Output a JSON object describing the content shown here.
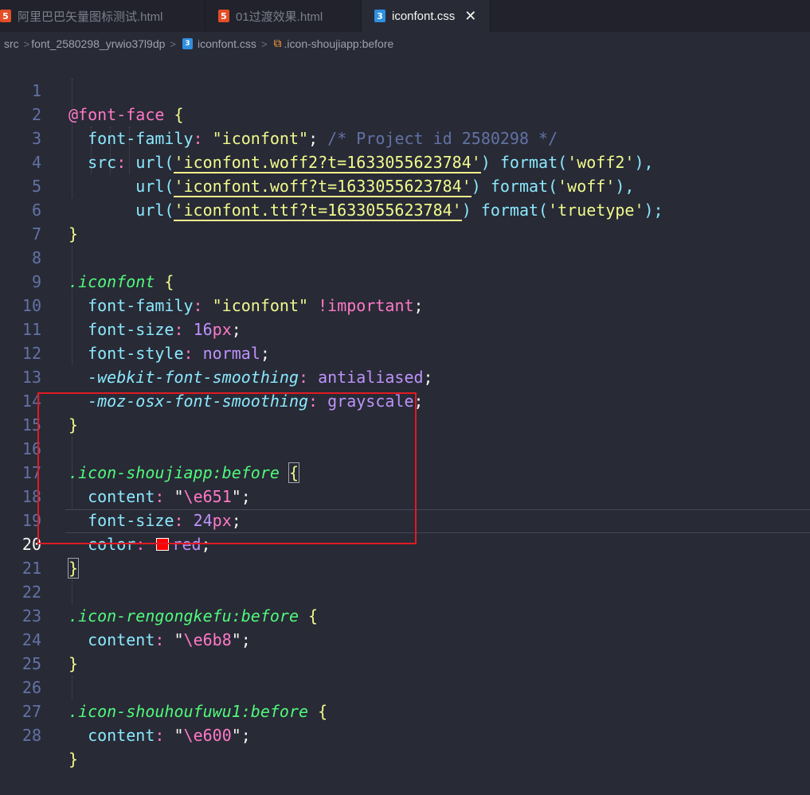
{
  "tabs": [
    {
      "label": "阿里巴巴矢量图标测试.html",
      "type": "html"
    },
    {
      "label": "01过渡效果.html",
      "type": "html"
    },
    {
      "label": "iconfont.css",
      "type": "css",
      "active": true
    }
  ],
  "tab_icons": {
    "html": "5",
    "css": "3"
  },
  "close_glyph": "✕",
  "breadcrumb": {
    "src": "src",
    "folder": "font_2580298_yrwio37l9dp",
    "file": "iconfont.css",
    "symbol": ".icon-shoujiapp:before",
    "sep": ">"
  },
  "icons": {
    "tab_html": "html5-file-icon",
    "tab_css": "css3-file-icon",
    "symbol": "selector-symbol-icon"
  },
  "colors": {
    "highlight_box": "#e01b24",
    "swatch_red": "#ff0000",
    "background": "#282a36"
  },
  "line_numbers": [
    "1",
    "2",
    "3",
    "4",
    "5",
    "6",
    "7",
    "8",
    "9",
    "10",
    "11",
    "12",
    "13",
    "14",
    "15",
    "16",
    "17",
    "18",
    "19",
    "20",
    "21",
    "22",
    "23",
    "24",
    "25",
    "26",
    "27",
    "28"
  ],
  "code": {
    "l1": {
      "at": "@font-face",
      "brace": "{"
    },
    "l2": {
      "prop": "font-family",
      "colon": ":",
      "str": "\"iconfont\"",
      "semi": ";",
      "comment": "/* Project id 2580298 */"
    },
    "l3": {
      "prop": "src",
      "colon": ":",
      "fn": "url(",
      "url": "'iconfont.woff2?t=1633055623784'",
      "close": ")",
      "fmt": "format(",
      "fmtval": "'woff2'",
      "end": "),"
    },
    "l4": {
      "fn": "url(",
      "url": "'iconfont.woff?t=1633055623784'",
      "close": ")",
      "fmt": "format(",
      "fmtval": "'woff'",
      "end": "),"
    },
    "l5": {
      "fn": "url(",
      "url": "'iconfont.ttf?t=1633055623784'",
      "close": ")",
      "fmt": "format(",
      "fmtval": "'truetype'",
      "end": ");"
    },
    "l6": {
      "brace": "}"
    },
    "l8": {
      "sel": ".iconfont",
      "brace": "{"
    },
    "l9": {
      "prop": "font-family",
      "colon": ":",
      "str": "\"iconfont\"",
      "imp": "!important",
      "semi": ";"
    },
    "l10": {
      "prop": "font-size",
      "colon": ":",
      "num": "16",
      "unit": "px",
      "semi": ";"
    },
    "l11": {
      "prop": "font-style",
      "colon": ":",
      "val": "normal",
      "semi": ";"
    },
    "l12": {
      "prop": "-webkit-font-smoothing",
      "colon": ":",
      "val": "antialiased",
      "semi": ";"
    },
    "l13": {
      "prop": "-moz-osx-font-smoothing",
      "colon": ":",
      "val": "grayscale",
      "semi": ";"
    },
    "l14": {
      "brace": "}"
    },
    "l16": {
      "sel": ".icon-shoujiapp",
      "pseudo": ":before",
      "brace": "{"
    },
    "l17": {
      "prop": "content",
      "colon": ":",
      "q1": "\"",
      "esc": "\\e651",
      "q2": "\"",
      "semi": ";"
    },
    "l18": {
      "prop": "font-size",
      "colon": ":",
      "num": "24",
      "unit": "px",
      "semi": ";"
    },
    "l19": {
      "prop": "color",
      "colon": ":",
      "val": "red",
      "semi": ";"
    },
    "l20": {
      "brace": "}"
    },
    "l22": {
      "sel": ".icon-rengongkefu",
      "pseudo": ":before",
      "brace": "{"
    },
    "l23": {
      "prop": "content",
      "colon": ":",
      "q1": "\"",
      "esc": "\\e6b8",
      "q2": "\"",
      "semi": ";"
    },
    "l24": {
      "brace": "}"
    },
    "l26": {
      "sel": ".icon-shouhoufuwu1",
      "pseudo": ":before",
      "brace": "{"
    },
    "l27": {
      "prop": "content",
      "colon": ":",
      "q1": "\"",
      "esc": "\\e600",
      "q2": "\"",
      "semi": ";"
    },
    "l28": {
      "brace": "}"
    }
  }
}
